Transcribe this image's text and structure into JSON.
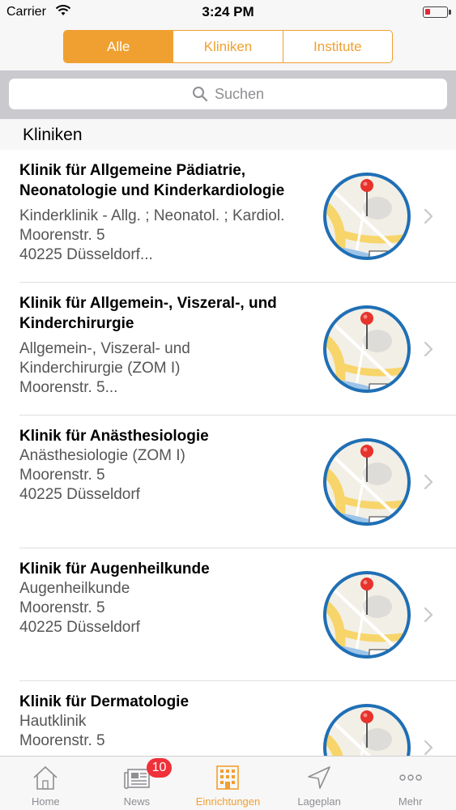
{
  "status_bar": {
    "carrier": "Carrier",
    "time": "3:24 PM"
  },
  "segments": [
    {
      "label": "Alle",
      "active": true
    },
    {
      "label": "Kliniken",
      "active": false
    },
    {
      "label": "Institute",
      "active": false
    }
  ],
  "search": {
    "placeholder": "Suchen"
  },
  "section": {
    "title": "Kliniken"
  },
  "rows": [
    {
      "title": "Klinik für Allgemeine Pädiatrie, Neonatologie und Kinderkardiologie",
      "subtitle": "Kinderklinik - Allg. ; Neonatol. ; Kardiol.\nMoorenstr. 5\n40225 Düsseldorf..."
    },
    {
      "title": "Klinik für Allgemein-, Viszeral-, und Kinderchirurgie",
      "subtitle": "Allgemein-, Viszeral- und\nKinderchirurgie (ZOM I)\nMoorenstr. 5..."
    },
    {
      "title": "Klinik für Anästhesiologie",
      "subtitle": "Anästhesiologie (ZOM I)\nMoorenstr. 5\n40225 Düsseldorf"
    },
    {
      "title": "Klinik für Augenheilkunde",
      "subtitle": "Augenheilkunde\nMoorenstr. 5\n40225 Düsseldorf"
    },
    {
      "title": "Klinik für Dermatologie",
      "subtitle": "Hautklinik\nMoorenstr. 5"
    }
  ],
  "tabs": [
    {
      "label": "Home",
      "icon": "home-icon"
    },
    {
      "label": "News",
      "icon": "newspaper-icon",
      "badge": "10"
    },
    {
      "label": "Einrichtungen",
      "icon": "building-icon",
      "active": true
    },
    {
      "label": "Lageplan",
      "icon": "location-arrow-icon"
    },
    {
      "label": "Mehr",
      "icon": "more-icon"
    }
  ],
  "colors": {
    "accent": "#f0a030",
    "badge": "#f0303a",
    "map_border": "#1f6fb5"
  }
}
